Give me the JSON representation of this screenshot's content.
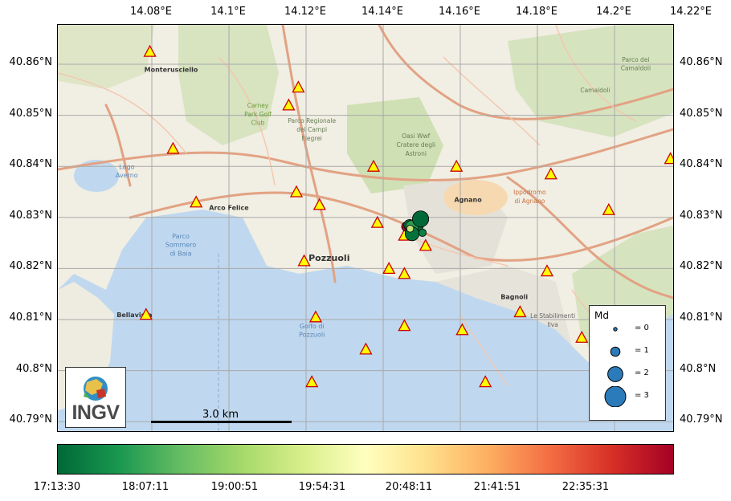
{
  "map": {
    "lon_ticks": [
      "14.08°E",
      "14.1°E",
      "14.12°E",
      "14.14°E",
      "14.16°E",
      "14.18°E",
      "14.2°E",
      "14.22°E"
    ],
    "lat_ticks": [
      "40.86°N",
      "40.85°N",
      "40.84°N",
      "40.83°N",
      "40.82°N",
      "40.81°N",
      "40.8°N",
      "40.79°N"
    ],
    "lon_values": [
      14.08,
      14.1,
      14.12,
      14.14,
      14.16,
      14.18,
      14.2,
      14.22
    ],
    "lat_values": [
      40.86,
      40.85,
      40.84,
      40.83,
      40.82,
      40.81,
      40.8,
      40.79
    ],
    "place_labels": [
      {
        "text": "Monterusciello",
        "lon": 14.085,
        "lat": 40.8585,
        "cls": "town"
      },
      {
        "text": "Arco Felice",
        "lon": 14.1,
        "lat": 40.8315,
        "cls": "town"
      },
      {
        "text": "Pozzuoli",
        "lon": 14.126,
        "lat": 40.8215,
        "cls": "city"
      },
      {
        "text": "Agnano",
        "lon": 14.162,
        "lat": 40.833,
        "cls": "town"
      },
      {
        "text": "Bagnoli",
        "lon": 14.174,
        "lat": 40.814,
        "cls": "town"
      },
      {
        "text": "Bellavista",
        "lon": 14.0755,
        "lat": 40.8105,
        "cls": "town"
      },
      {
        "text": "Lago",
        "lon": 14.0735,
        "lat": 40.8395,
        "cls": "water"
      },
      {
        "text": "Averno",
        "lon": 14.0735,
        "lat": 40.8378,
        "cls": "water"
      },
      {
        "text": "Golfo di",
        "lon": 14.1215,
        "lat": 40.8083,
        "cls": "water"
      },
      {
        "text": "Pozzuoli",
        "lon": 14.1215,
        "lat": 40.8066,
        "cls": "water"
      },
      {
        "text": "Parco",
        "lon": 14.0875,
        "lat": 40.8259,
        "cls": "water"
      },
      {
        "text": "Sommero",
        "lon": 14.0875,
        "lat": 40.8242,
        "cls": "water"
      },
      {
        "text": "di Baia",
        "lon": 14.0875,
        "lat": 40.8225,
        "cls": "water"
      },
      {
        "text": "Carney",
        "lon": 14.1075,
        "lat": 40.8515,
        "cls": "park"
      },
      {
        "text": "Park Golf",
        "lon": 14.1075,
        "lat": 40.8498,
        "cls": "park"
      },
      {
        "text": "Club",
        "lon": 14.1075,
        "lat": 40.8481,
        "cls": "park"
      },
      {
        "text": "Parco Regionale",
        "lon": 14.1215,
        "lat": 40.8485,
        "cls": "parkdark"
      },
      {
        "text": "dei Campi",
        "lon": 14.1215,
        "lat": 40.8468,
        "cls": "parkdark"
      },
      {
        "text": "Flegrei",
        "lon": 14.1215,
        "lat": 40.8451,
        "cls": "parkdark"
      },
      {
        "text": "Oasi Wwf",
        "lon": 14.1485,
        "lat": 40.8455,
        "cls": "parkdark"
      },
      {
        "text": "Cratere degli",
        "lon": 14.1485,
        "lat": 40.8438,
        "cls": "parkdark"
      },
      {
        "text": "Astroni",
        "lon": 14.1485,
        "lat": 40.8421,
        "cls": "parkdark"
      },
      {
        "text": "Ippodromo",
        "lon": 14.178,
        "lat": 40.8345,
        "cls": "orange"
      },
      {
        "text": "di Agnano",
        "lon": 14.178,
        "lat": 40.8328,
        "cls": "orange"
      },
      {
        "text": "Camaldoli",
        "lon": 14.195,
        "lat": 40.8545,
        "cls": "parkdark"
      },
      {
        "text": "Parco dei",
        "lon": 14.2055,
        "lat": 40.8605,
        "cls": "parkdark"
      },
      {
        "text": "Camaldoli",
        "lon": 14.2055,
        "lat": 40.8588,
        "cls": "parkdark"
      },
      {
        "text": "Le Stabilimenti",
        "lon": 14.184,
        "lat": 40.8103,
        "cls": "small"
      },
      {
        "text": "Ilva",
        "lon": 14.184,
        "lat": 40.8086,
        "cls": "small"
      }
    ],
    "stations": [
      {
        "lon": 14.0795,
        "lat": 40.8625
      },
      {
        "lon": 14.118,
        "lat": 40.8555
      },
      {
        "lon": 14.1155,
        "lat": 40.852
      },
      {
        "lon": 14.0855,
        "lat": 40.8435
      },
      {
        "lon": 14.0915,
        "lat": 40.833
      },
      {
        "lon": 14.1375,
        "lat": 40.84
      },
      {
        "lon": 14.159,
        "lat": 40.84
      },
      {
        "lon": 14.1835,
        "lat": 40.8385
      },
      {
        "lon": 14.1175,
        "lat": 40.835
      },
      {
        "lon": 14.1235,
        "lat": 40.8325
      },
      {
        "lon": 14.1985,
        "lat": 40.8315
      },
      {
        "lon": 14.2145,
        "lat": 40.8415
      },
      {
        "lon": 14.1385,
        "lat": 40.829
      },
      {
        "lon": 14.1455,
        "lat": 40.8265
      },
      {
        "lon": 14.151,
        "lat": 40.8245
      },
      {
        "lon": 14.1195,
        "lat": 40.8215
      },
      {
        "lon": 14.1415,
        "lat": 40.82
      },
      {
        "lon": 14.1455,
        "lat": 40.819
      },
      {
        "lon": 14.1825,
        "lat": 40.8195
      },
      {
        "lon": 14.0785,
        "lat": 40.811
      },
      {
        "lon": 14.1225,
        "lat": 40.8105
      },
      {
        "lon": 14.1755,
        "lat": 40.8115
      },
      {
        "lon": 14.1455,
        "lat": 40.8088
      },
      {
        "lon": 14.1605,
        "lat": 40.808
      },
      {
        "lon": 14.1915,
        "lat": 40.8065
      },
      {
        "lon": 14.1355,
        "lat": 40.8042
      },
      {
        "lon": 14.1215,
        "lat": 40.7978
      },
      {
        "lon": 14.1665,
        "lat": 40.7978
      }
    ],
    "events": [
      {
        "lon": 14.146,
        "lat": 40.8282,
        "md": 1.0,
        "t": 0.99
      },
      {
        "lon": 14.1468,
        "lat": 40.8285,
        "md": 1.3,
        "t": 0.03
      },
      {
        "lon": 14.1488,
        "lat": 40.8285,
        "md": 1.6,
        "t": 0.01
      },
      {
        "lon": 14.1475,
        "lat": 40.8282,
        "md": 1.6,
        "t": 0.12
      },
      {
        "lon": 14.1475,
        "lat": 40.8268,
        "md": 1.8,
        "t": 0.02
      },
      {
        "lon": 14.1497,
        "lat": 40.8297,
        "md": 2.2,
        "t": 0.0
      },
      {
        "lon": 14.1502,
        "lat": 40.827,
        "md": 0.7,
        "t": 0.05
      },
      {
        "lon": 14.147,
        "lat": 40.8278,
        "md": 0.6,
        "t": 0.35
      }
    ]
  },
  "scale_bar": {
    "label": "3.0 km"
  },
  "legend": {
    "title": "Md",
    "items": [
      {
        "label": "= 0",
        "md": 0
      },
      {
        "label": "= 1",
        "md": 1
      },
      {
        "label": "= 2",
        "md": 2
      },
      {
        "label": "= 3",
        "md": 3
      }
    ]
  },
  "logo": {
    "text": "INGV"
  },
  "colorbar": {
    "labels": [
      "17:13:30",
      "18:07:11",
      "19:00:51",
      "19:54:31",
      "20:48:11",
      "21:41:51",
      "22:35:31"
    ]
  },
  "colors": {
    "water": "#bfd8ef",
    "land": "#f1eee3",
    "park": "#cfe0b4",
    "grid": "#a9a9a9",
    "station_fill": "#ffff00",
    "station_edge": "#cc0000",
    "event_edge": "#000000"
  }
}
